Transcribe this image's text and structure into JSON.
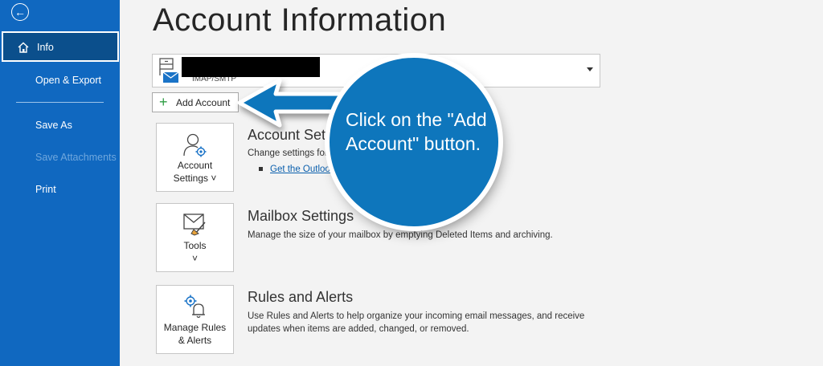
{
  "sidebar": {
    "back_icon": "arrow-left-icon",
    "items": [
      {
        "label": "Info",
        "selected": true
      },
      {
        "label": "Open & Export"
      },
      {
        "label": "Save As"
      },
      {
        "label": "Save Attachments",
        "disabled": true
      },
      {
        "label": "Print"
      }
    ]
  },
  "main": {
    "title": "Account Information",
    "account": {
      "type": "IMAP/SMTP"
    },
    "add_account_label": "Add Account",
    "sections": [
      {
        "tile_label_1": "Account",
        "tile_label_2": "Settings ˅",
        "title": "Account Settings",
        "desc": "Change settings for this account or set up more connections.",
        "link": "Get the Outlook app for iOS or Android."
      },
      {
        "tile_label_1": "Tools",
        "tile_label_2": "˅",
        "title": "Mailbox Settings",
        "desc": "Manage the size of your mailbox by emptying Deleted Items and archiving."
      },
      {
        "tile_label_1": "Manage Rules",
        "tile_label_2": "& Alerts",
        "title": "Rules and Alerts",
        "desc_1": "Use Rules and Alerts to help organize your incoming email messages, and receive",
        "desc_2": "updates when items are added, changed, or removed."
      }
    ]
  },
  "callout": {
    "line_1": "Click on the \"Add",
    "line_2": "Account\" button."
  },
  "colors": {
    "sidebar": "#1068c0",
    "callout": "#0e76bc",
    "link": "#0a5fad"
  }
}
